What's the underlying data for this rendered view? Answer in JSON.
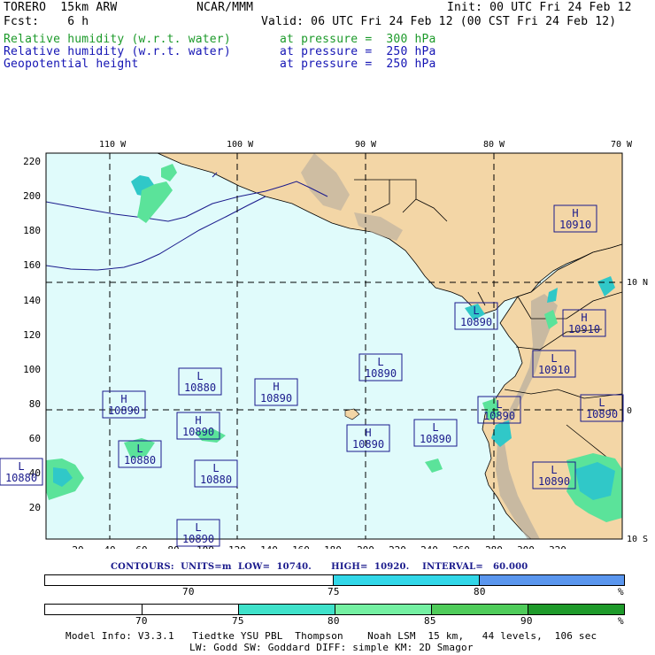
{
  "header": {
    "model": "TORERO  15km ARW",
    "center": "NCAR/MMM",
    "init": "Init: 00 UTC Fri 24 Feb 12",
    "fcst": "Fcst:    6 h",
    "valid": "Valid: 06 UTC Fri 24 Feb 12 (00 CST Fri 24 Feb 12)"
  },
  "fields": [
    {
      "name": "Relative humidity (w.r.t. water)",
      "level": "at pressure =  300 hPa",
      "color": "#1c9a2a"
    },
    {
      "name": "Relative humidity (w.r.t. water)",
      "level": "at pressure =  250 hPa",
      "color": "#1414b4"
    },
    {
      "name": "Geopotential height",
      "level": "at pressure =  250 hPa",
      "color": "#1414b4"
    }
  ],
  "map": {
    "lon_labels": [
      "110 W",
      "100 W",
      "90 W",
      "80 W",
      "70 W"
    ],
    "lat_labels": [
      "10 N",
      "0",
      "10 S"
    ],
    "x_ticks": [
      "20",
      "40",
      "60",
      "80",
      "100",
      "120",
      "140",
      "160",
      "180",
      "200",
      "220",
      "240",
      "260",
      "280",
      "300",
      "320"
    ],
    "y_ticks": [
      "220",
      "200",
      "180",
      "160",
      "140",
      "120",
      "100",
      "80",
      "60",
      "40",
      "20"
    ],
    "colors": {
      "ocean": "#e0fbfb",
      "land": "#f3d6a6",
      "terrain": "#b5aca0",
      "rh_green": "#5be39a",
      "rh_teal": "#30c8c8",
      "contour": "#1a1a8c"
    },
    "centers": [
      {
        "type": "H",
        "value": "10910"
      },
      {
        "type": "H",
        "value": "10910"
      },
      {
        "type": "H",
        "value": "10890"
      },
      {
        "type": "H",
        "value": "10890"
      },
      {
        "type": "H",
        "value": "10890"
      },
      {
        "type": "H",
        "value": "10890"
      },
      {
        "type": "L",
        "value": "10910"
      },
      {
        "type": "L",
        "value": "10890"
      },
      {
        "type": "L",
        "value": "10890"
      },
      {
        "type": "L",
        "value": "10880"
      },
      {
        "type": "L",
        "value": "10890"
      },
      {
        "type": "L",
        "value": "10880"
      },
      {
        "type": "L",
        "value": "10880"
      },
      {
        "type": "L",
        "value": "10890"
      },
      {
        "type": "L",
        "value": "10890"
      },
      {
        "type": "L",
        "value": "10890"
      },
      {
        "type": "L",
        "value": "10880"
      },
      {
        "type": "L",
        "value": "10890"
      }
    ]
  },
  "contour_info": {
    "text": "CONTOURS:  UNITS=m  LOW=  10740.      HIGH=  10920.    INTERVAL=   60.000"
  },
  "legend1": {
    "labels": [
      "70",
      "75",
      "80"
    ],
    "unit": "%",
    "colors": [
      "#ffffff",
      "#32d7e8",
      "#5a96ee"
    ]
  },
  "legend2": {
    "labels": [
      "70",
      "75",
      "80",
      "85",
      "90"
    ],
    "unit": "%",
    "colors": [
      "#ffffff",
      "#ffffff",
      "#3fe2ca",
      "#74f0a2",
      "#4fcc5a",
      "#1e9a2a"
    ]
  },
  "footer": {
    "line1": "Model Info: V3.3.1   Tiedtke YSU PBL  Thompson    Noah LSM  15 km,   44 levels,  106 sec",
    "line2": "LW: Godd SW: Goddard DIFF: simple KM: 2D Smagor"
  }
}
